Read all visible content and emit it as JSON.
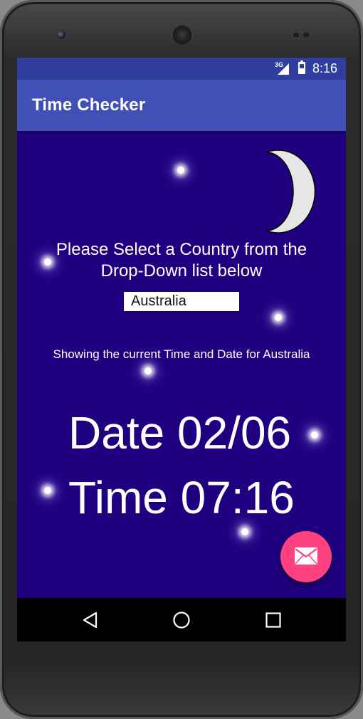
{
  "status_bar": {
    "network": "3G",
    "time": "8:16"
  },
  "app_bar": {
    "title": "Time Checker"
  },
  "main": {
    "prompt_line1": "Please Select a Country from the",
    "prompt_line2": "Drop-Down list below",
    "country_select": {
      "selected": "Australia"
    },
    "showing_text": "Showing the current Time and Date for Australia",
    "date_line": "Date 02/06",
    "time_line": "Time 07:16",
    "background_color": "#200080"
  },
  "fab": {
    "icon": "email-icon",
    "color": "#ff4081"
  },
  "nav_bar": {
    "icons": [
      "back-icon",
      "home-icon",
      "recents-icon"
    ]
  },
  "colors": {
    "status_bar": "#303f9f",
    "app_bar": "#3f51b5"
  }
}
